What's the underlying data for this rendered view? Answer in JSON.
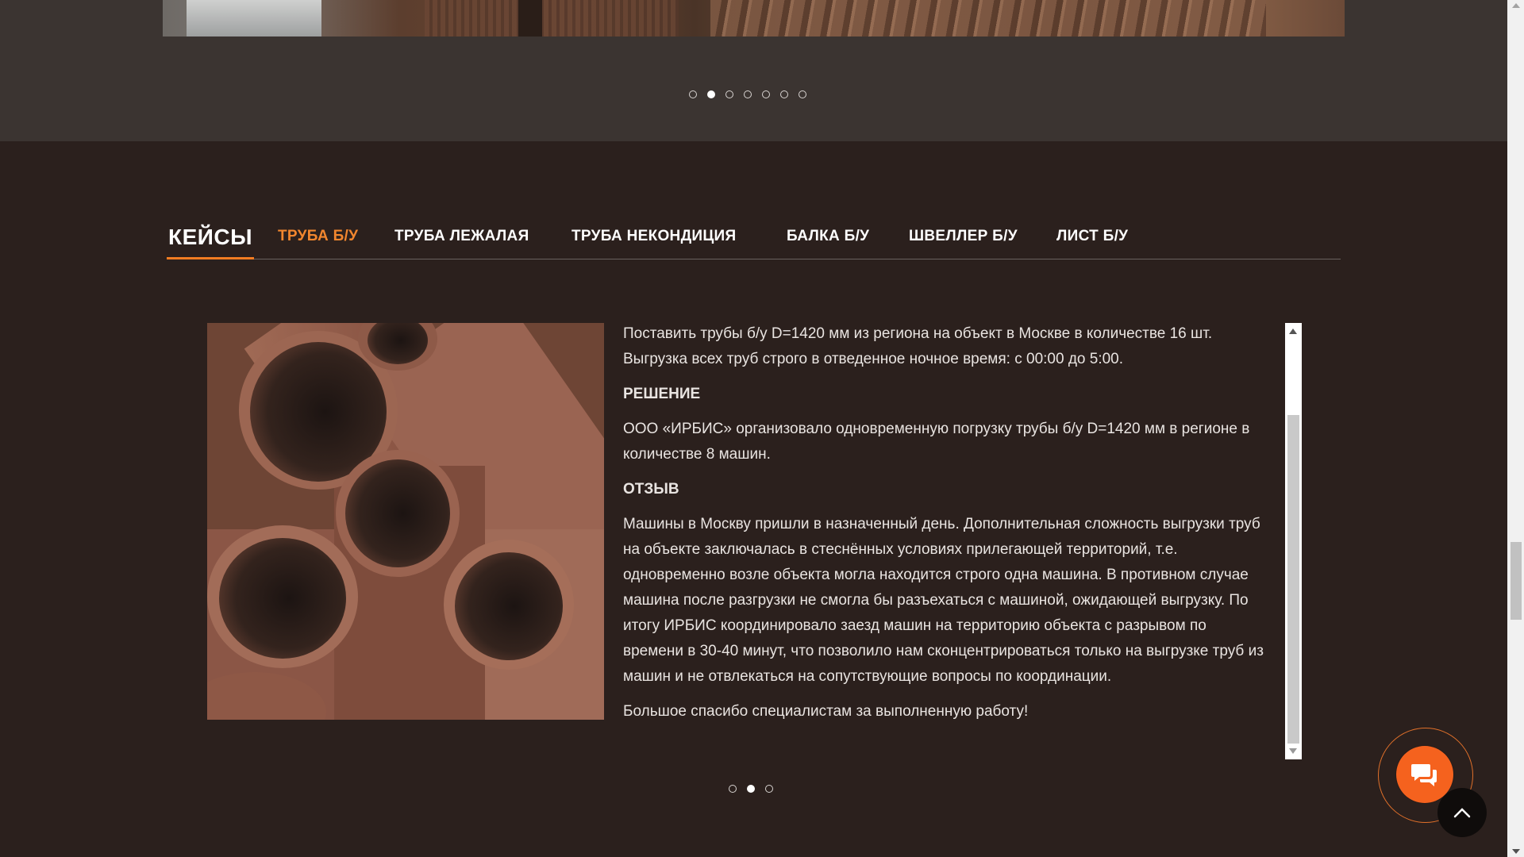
{
  "top_slider": {
    "dots_count": 7,
    "active_index": 1
  },
  "cases": {
    "heading": "КЕЙСЫ",
    "tabs": [
      {
        "label": "ТРУБА Б/У",
        "active": true
      },
      {
        "label": "ТРУБА ЛЕЖАЛАЯ",
        "active": false
      },
      {
        "label": "ТРУБА НЕКОНДИЦИЯ",
        "active": false
      },
      {
        "label": "БАЛКА Б/У",
        "active": false
      },
      {
        "label": "ШВЕЛЛЕР Б/У",
        "active": false
      },
      {
        "label": "ЛИСТ Б/У",
        "active": false
      }
    ],
    "task_text": "Поставить трубы б/у D=1420 мм из региона на объект в Москве в количестве 16 шт. Выгрузка всех труб строго в отведенное ночное время: с 00:00 до 5:00.",
    "solution_heading": "РЕШЕНИЕ",
    "solution_text": "ООО «ИРБИС» организовало одновременную погрузку трубы б/у D=1420 мм в регионе в количестве 8 машин.",
    "review_heading": "ОТЗЫВ",
    "review_text": "Машины в Москву пришли в назначенный день. Дополнительная сложность выгрузки труб на объекте заключалась в стеснённых условиях прилегающей территорий, т.е. одновременно возле объекта могла находится строго одна машина. В противном случае машина после разгрузки не смогла бы разъехаться с машиной, ожидающей выгрузку. По итогу ИРБИС координировало заезд машин на территорию объекта с разрывом по времени в 30-40 минут, что позволило нам сконцентрироваться только на выгрузке труб из машин и не отвлекаться на сопутствующие вопросы по координации.",
    "thanks_text": "Большое спасибо специалистам за выполненную работу!",
    "dots_count": 3,
    "active_index": 1
  },
  "colors": {
    "accent": "#f2862e",
    "section_bg": "#2b201d",
    "top_bg": "#3b3431",
    "chat": "#f5621e"
  },
  "icons": {
    "chat": "chat-bubbles-icon",
    "to_top": "chevron-up-icon"
  }
}
